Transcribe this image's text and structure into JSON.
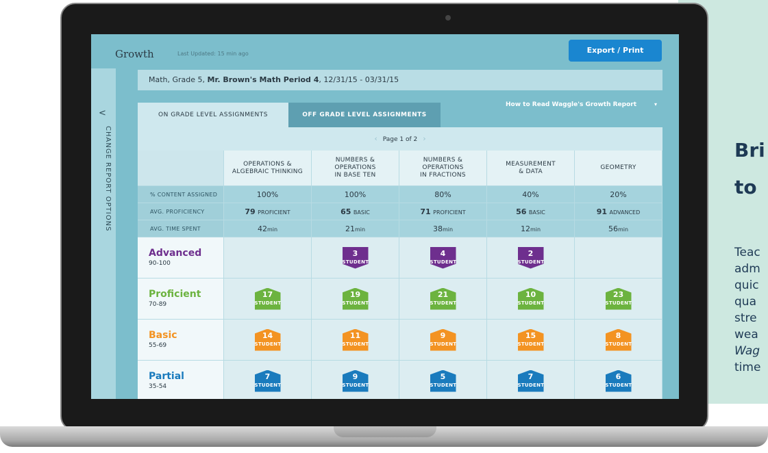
{
  "app": {
    "title": "Growth",
    "updated": "Last Updated: 15 min ago",
    "export_label": "Export / Print"
  },
  "sidebar": {
    "chevron": "<",
    "label": "CHANGE REPORT OPTIONS"
  },
  "filter": {
    "prefix": "Math, Grade 5, ",
    "teacher": "Mr. Brown's Math Period 4",
    "range": ", 12/31/15 - 03/31/15"
  },
  "tabs": [
    {
      "label": "ON GRADE LEVEL ASSIGNMENTS"
    },
    {
      "label": "OFF GRADE LEVEL ASSIGNMENTS"
    }
  ],
  "howto": {
    "label": "How to Read Waggle's Growth Report",
    "chevron": "▾"
  },
  "pager": {
    "prev": "‹",
    "label": "Page 1 of 2",
    "next": "›"
  },
  "columns": [
    {
      "line1": "OPERATIONS &",
      "line2": "ALGEBRAIC THINKING",
      "line3": ""
    },
    {
      "line1": "NUMBERS &",
      "line2": "OPERATIONS",
      "line3": "IN BASE TEN"
    },
    {
      "line1": "NUMBERS &",
      "line2": "OPERATIONS",
      "line3": "IN FRACTIONS"
    },
    {
      "line1": "MEASUREMENT",
      "line2": "& DATA",
      "line3": ""
    },
    {
      "line1": "GEOMETRY",
      "line2": "",
      "line3": ""
    }
  ],
  "stats": {
    "content": {
      "label": "% CONTENT ASSIGNED",
      "values": [
        "100%",
        "100%",
        "80%",
        "40%",
        "20%"
      ]
    },
    "proficiency": {
      "label": "AVG. PROFICIENCY",
      "scores": [
        "79",
        "65",
        "71",
        "56",
        "91"
      ],
      "levels": [
        "PROFICIENT",
        "BASIC",
        "PROFICIENT",
        "BASIC",
        "ADVANCED"
      ]
    },
    "time": {
      "label": "AVG. TIME SPENT",
      "values": [
        "42",
        "21",
        "38",
        "12",
        "56"
      ],
      "unit": "min"
    }
  },
  "levels": [
    {
      "name": "Advanced",
      "range": "90-100",
      "color": "#6e2f8e",
      "counts": [
        "",
        "3",
        "4",
        "2",
        ""
      ]
    },
    {
      "name": "Proficient",
      "range": "70-89",
      "color": "#6cb33f",
      "counts": [
        "17",
        "19",
        "21",
        "10",
        "23"
      ]
    },
    {
      "name": "Basic",
      "range": "55-69",
      "color": "#f39322",
      "counts": [
        "14",
        "11",
        "9",
        "15",
        "8"
      ]
    },
    {
      "name": "Partial",
      "range": "35-54",
      "color": "#1a7bbd",
      "counts": [
        "7",
        "9",
        "5",
        "7",
        "6"
      ]
    }
  ],
  "badge_label": "STUDENTS",
  "marketing": {
    "h1": "Bri",
    "h2": "to",
    "lines": [
      "Teac",
      "adm",
      "quic",
      "qua",
      "stre",
      "wea",
      "Wag",
      "time"
    ]
  },
  "colors": {
    "accent": "#1a86d0",
    "screen_bg": "#7cbecc",
    "mint": "#cde8e0"
  }
}
